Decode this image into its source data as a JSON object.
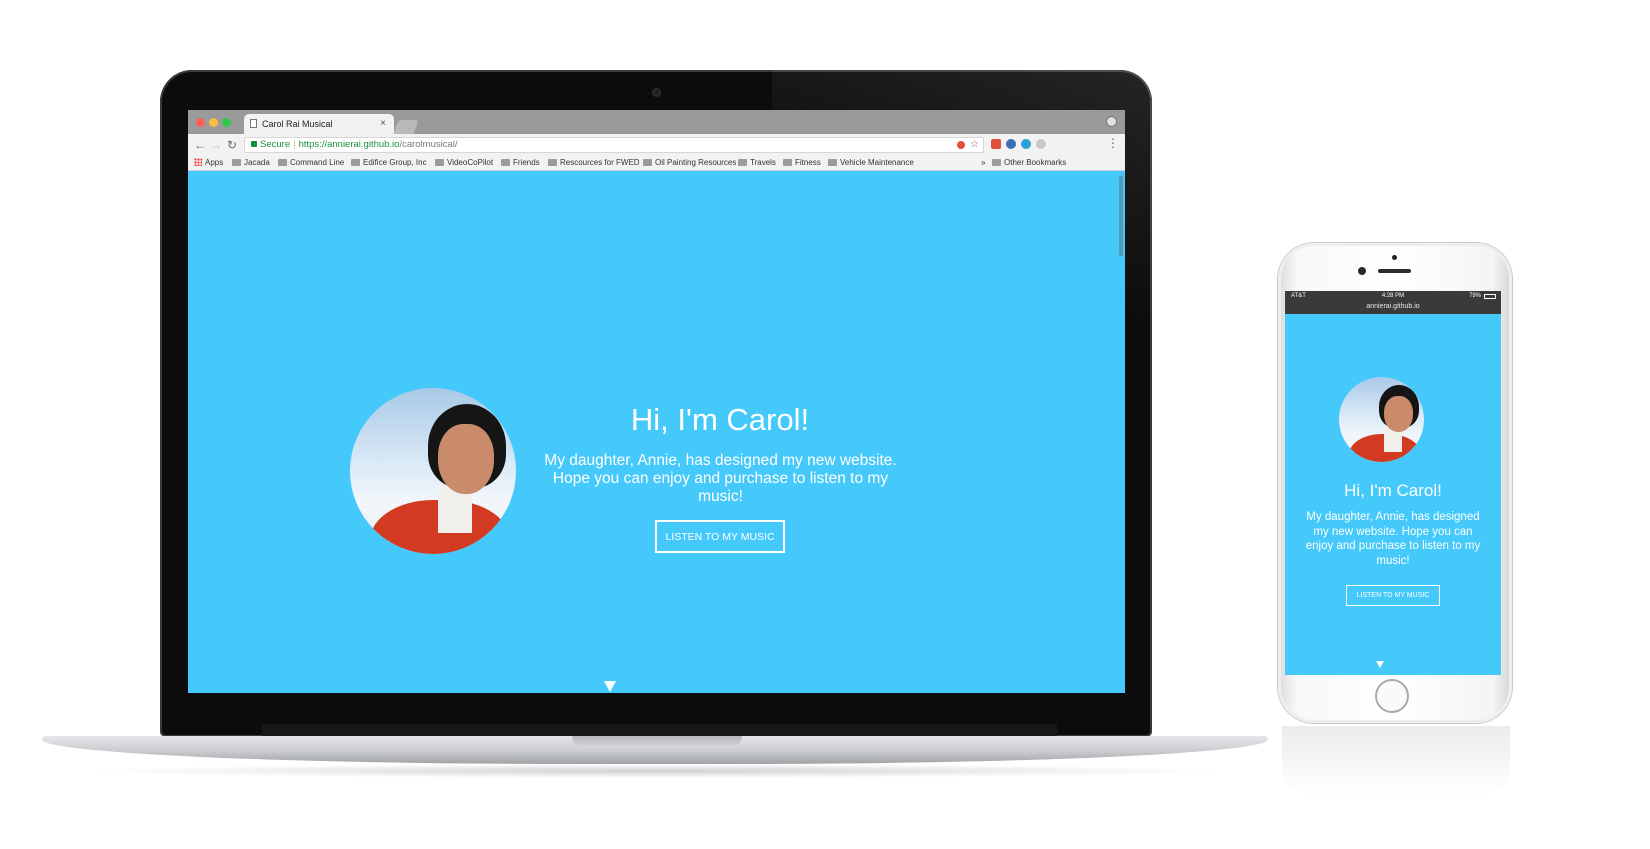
{
  "browser": {
    "tab_title": "Carol Rai Musical",
    "tab_close": "×",
    "secure_label": "Secure",
    "url_host": "https://annierai.github.io",
    "url_path": "/carolmusical/",
    "bookmarks": [
      "Apps",
      "Jacada",
      "Command Line",
      "Edifice Group, Inc",
      "VideoCoPilot",
      "Friends",
      "Rescources for FWED",
      "Oil Painting Resources",
      "Travels",
      "Fitness",
      "Vehicle Maintenance"
    ],
    "bookmarks_overflow": "»",
    "other_bookmarks": "Other Bookmarks"
  },
  "hero": {
    "title": "Hi, I'm Carol!",
    "text_desktop": "My daughter, Annie, has designed my new website. Hope you can enjoy and purchase to listen to my music!",
    "text_mobile": "My daughter, Annie, has designed my new website. Hope you can enjoy and purchase to listen to my music!",
    "button_label": "LISTEN TO MY MUSIC"
  },
  "phone": {
    "carrier": "AT&T",
    "time": "4:28 PM",
    "battery": "79%",
    "url": "annierai.github.io"
  },
  "colors": {
    "page_bg": "#45c9fb",
    "text": "#ffffff",
    "coat": "#d23a22"
  }
}
